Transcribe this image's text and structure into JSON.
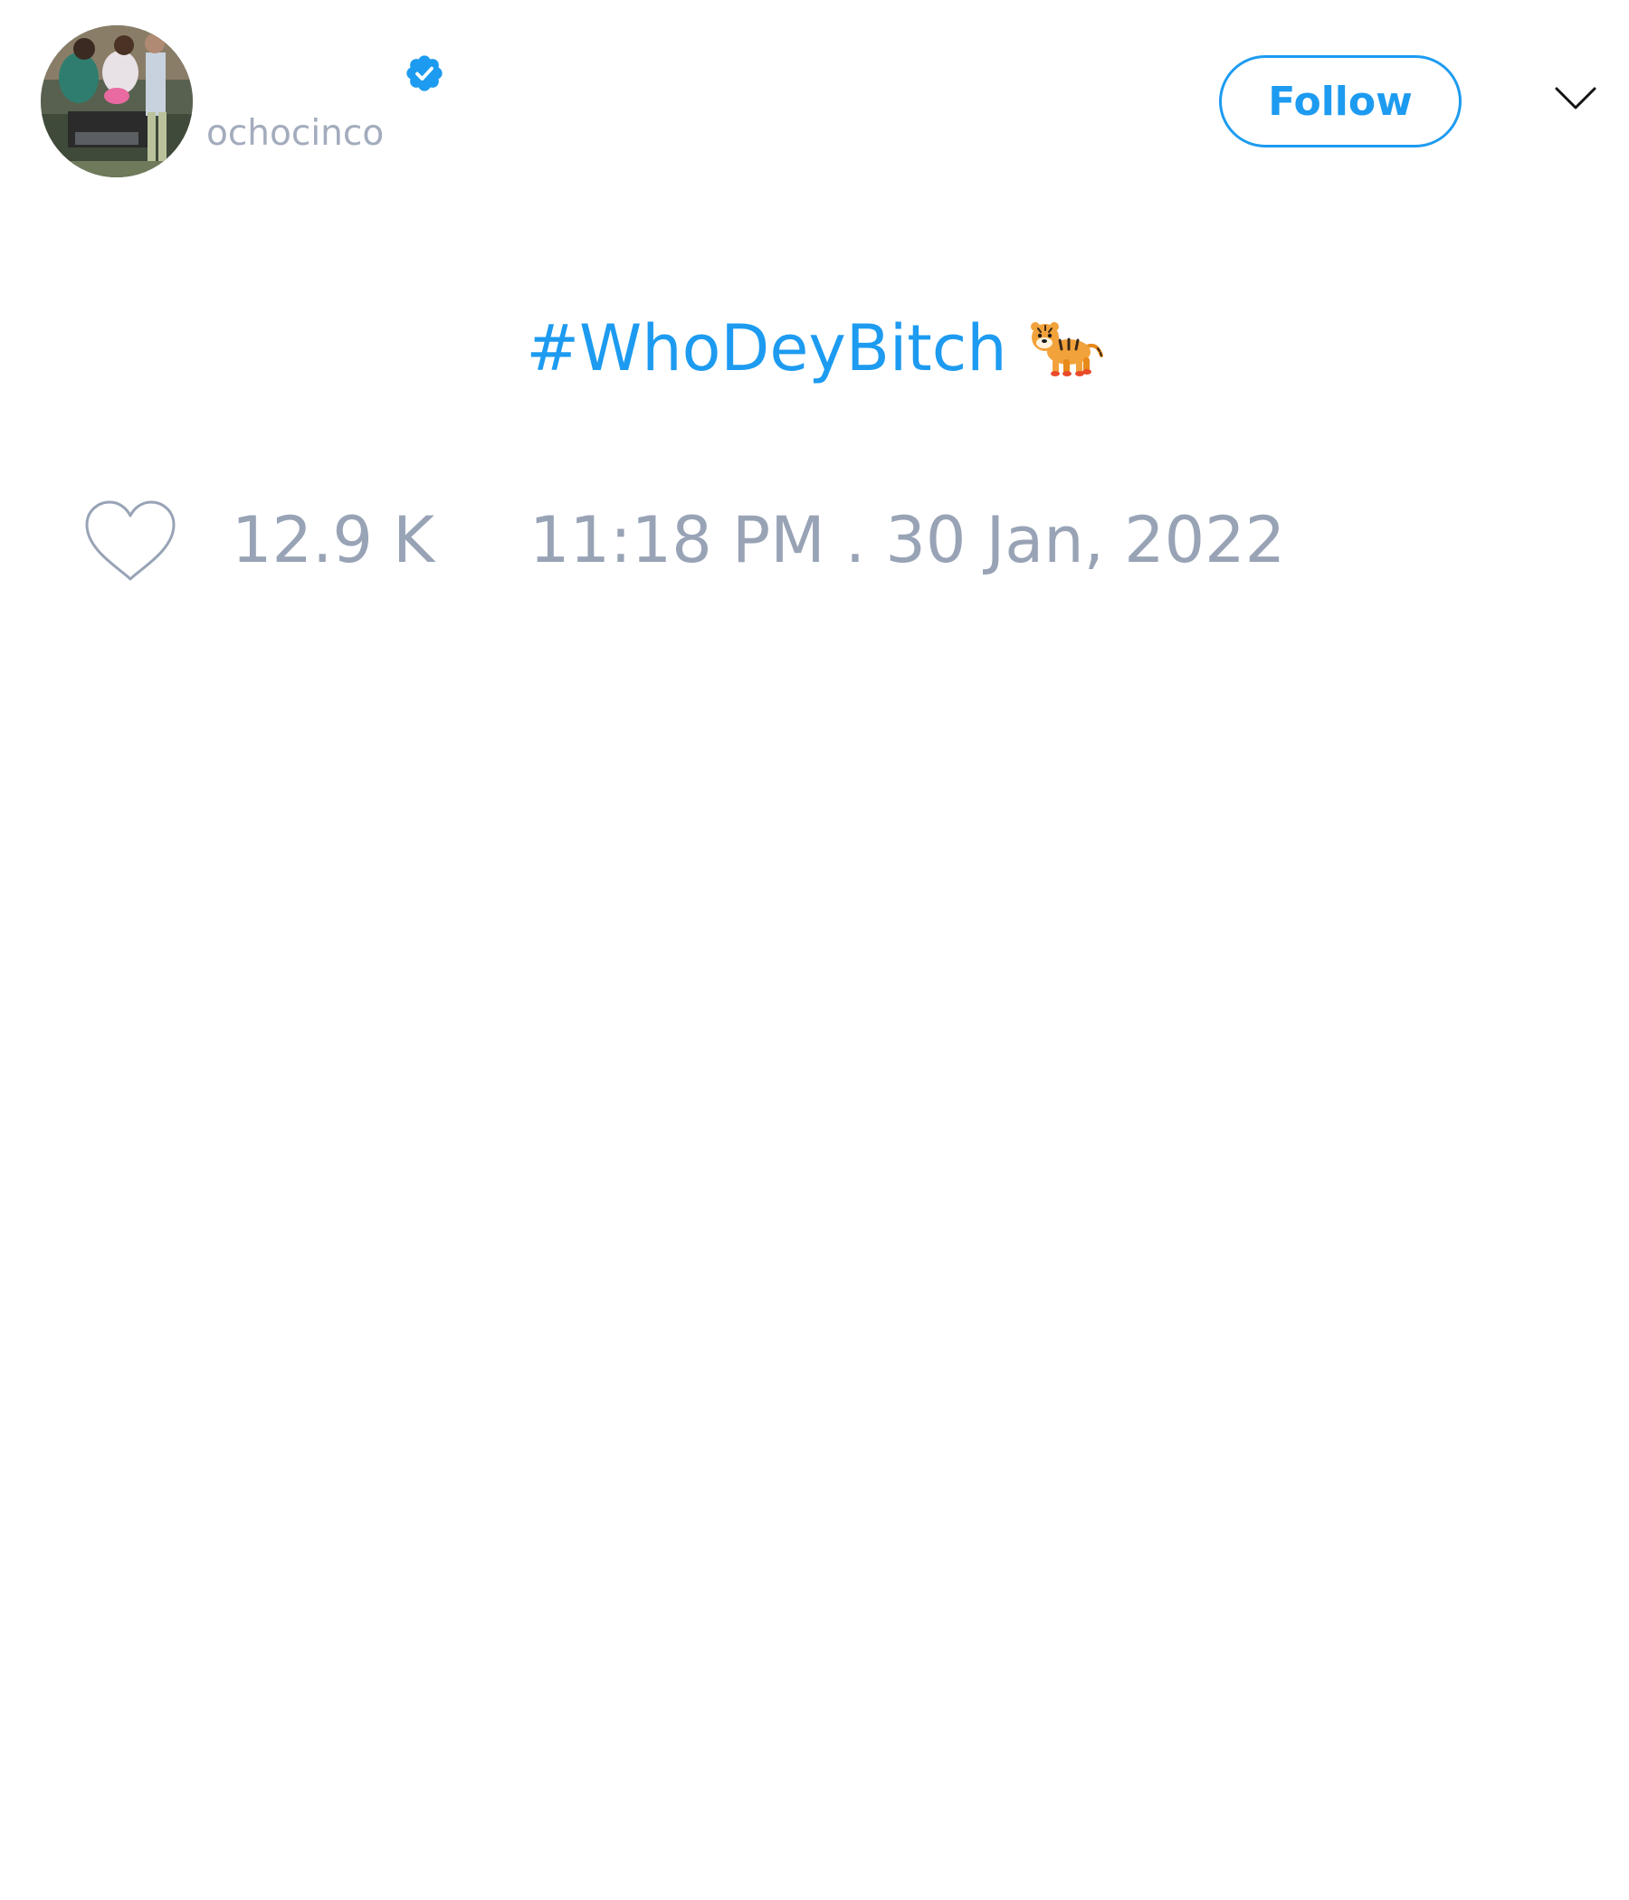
{
  "tweet": {
    "author": {
      "handle": "ochocinco",
      "verified": true,
      "avatar_icon": "profile-photo"
    },
    "follow_label": "Follow",
    "more_icon": "chevron-down-icon",
    "text": {
      "hashtag": "#WhoDeyBitch",
      "emoji": "tiger"
    },
    "likes": "12.9 K",
    "timestamp": "11:18 PM . 30 Jan, 2022"
  },
  "colors": {
    "accent": "#1d9bf0",
    "muted": "#98a3b6",
    "background": "#ffffff"
  }
}
